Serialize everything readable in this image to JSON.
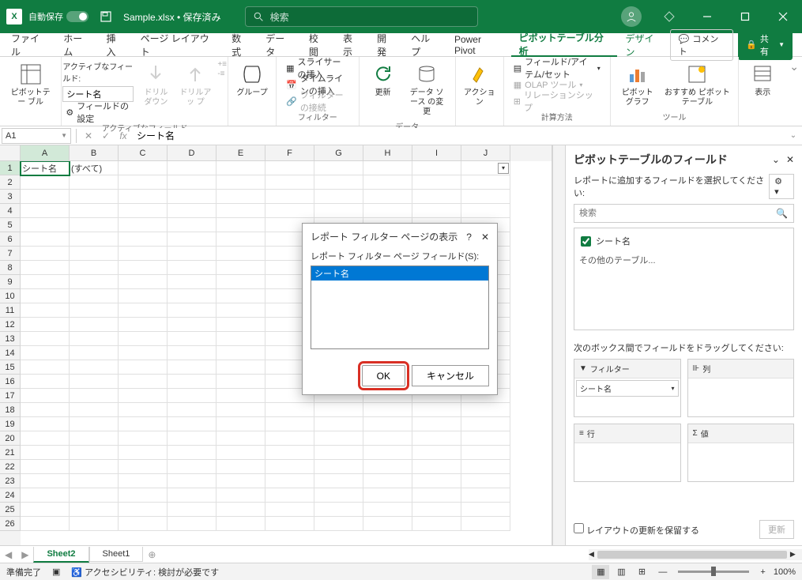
{
  "titlebar": {
    "autosave_label": "自動保存",
    "filename": "Sample.xlsx • 保存済み",
    "search_label": "検索"
  },
  "tabs": {
    "file": "ファイル",
    "home": "ホーム",
    "insert": "挿入",
    "pagelayout": "ページ レイアウト",
    "formulas": "数式",
    "data": "データ",
    "review": "校閲",
    "view": "表示",
    "developer": "開発",
    "help": "ヘルプ",
    "powerpivot": "Power Pivot",
    "ptanalyze": "ピボットテーブル分析",
    "design": "デザイン",
    "comments": "コメント",
    "share": "共有"
  },
  "ribbon": {
    "pt_btn": "ピボットテー\nブル",
    "active_field_label": "アクティブなフィールド:",
    "active_field_value": "シート名",
    "field_settings": "フィールドの設定",
    "drilldown": "ドリル\nダウン",
    "drillup": "ドリルアッ\nプ",
    "active_field_group": "アクティブなフィールド",
    "group_btn": "グループ",
    "slicer": "スライサーの挿入",
    "timeline": "タイムラインの挿入",
    "filter_conn": "フィルターの接続",
    "filter_group": "フィルター",
    "refresh": "更新",
    "datasource": "データ ソース\nの変更",
    "data_group": "データ",
    "actions": "アクション",
    "field_item": "フィールド/アイテム/セット",
    "olap": "OLAP ツール",
    "relationships": "リレーションシップ",
    "calc_group": "計算方法",
    "pivotchart": "ピボットグラフ",
    "recommend": "おすすめ\nピボットテーブル",
    "display": "表示",
    "tools_group": "ツール"
  },
  "formula_bar": {
    "name_box": "A1",
    "formula": "シート名"
  },
  "cols": [
    "A",
    "B",
    "C",
    "D",
    "E",
    "F",
    "G",
    "H",
    "I",
    "J"
  ],
  "cells": {
    "A1": "シート名",
    "B1": "(すべて)"
  },
  "pivot": {
    "title": "ピボットテーブルのフィールド",
    "sub": "レポートに追加するフィールドを選択してください:",
    "search_ph": "検索",
    "field1": "シート名",
    "other": "その他のテーブル...",
    "drag_label": "次のボックス間でフィールドをドラッグしてください:",
    "filters": "フィルター",
    "columns": "列",
    "rows": "行",
    "values": "値",
    "item1": "シート名",
    "defer": "レイアウトの更新を保留する",
    "update": "更新"
  },
  "sheets": {
    "s2": "Sheet2",
    "s1": "Sheet1"
  },
  "statusbar": {
    "ready": "準備完了",
    "accessibility": "アクセシビリティ: 検討が必要です",
    "zoom": "100%"
  },
  "dialog": {
    "title": "レポート フィルター ページの表示",
    "label": "レポート フィルター ページ フィールド(S):",
    "item": "シート名",
    "ok": "OK",
    "cancel": "キャンセル"
  }
}
